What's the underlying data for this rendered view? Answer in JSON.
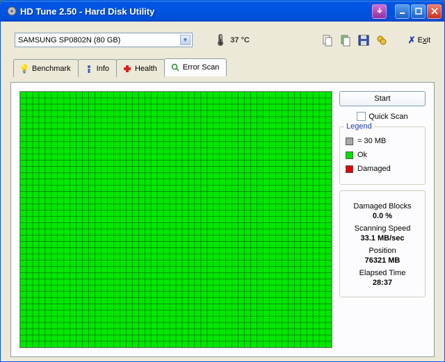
{
  "window": {
    "title": "HD Tune 2.50 - Hard Disk Utility"
  },
  "toolbar": {
    "drive": "SAMSUNG SP0802N (80 GB)",
    "temperature": "37 °C",
    "exit_label": "Exit",
    "exit_key": "x"
  },
  "tabs": {
    "benchmark": "Benchmark",
    "info": "Info",
    "health": "Health",
    "error_scan": "Error Scan"
  },
  "scan": {
    "start_label": "Start",
    "quick_scan_label": "Quick Scan",
    "quick_scan_checked": false
  },
  "legend": {
    "title": "Legend",
    "block_size": "= 30 MB",
    "ok": "Ok",
    "damaged": "Damaged"
  },
  "stats": {
    "damaged_blocks_label": "Damaged Blocks",
    "damaged_blocks_value": "0.0 %",
    "scanning_speed_label": "Scanning Speed",
    "scanning_speed_value": "33.1 MB/sec",
    "position_label": "Position",
    "position_value": "76321 MB",
    "elapsed_time_label": "Elapsed Time",
    "elapsed_time_value": "28:37"
  }
}
